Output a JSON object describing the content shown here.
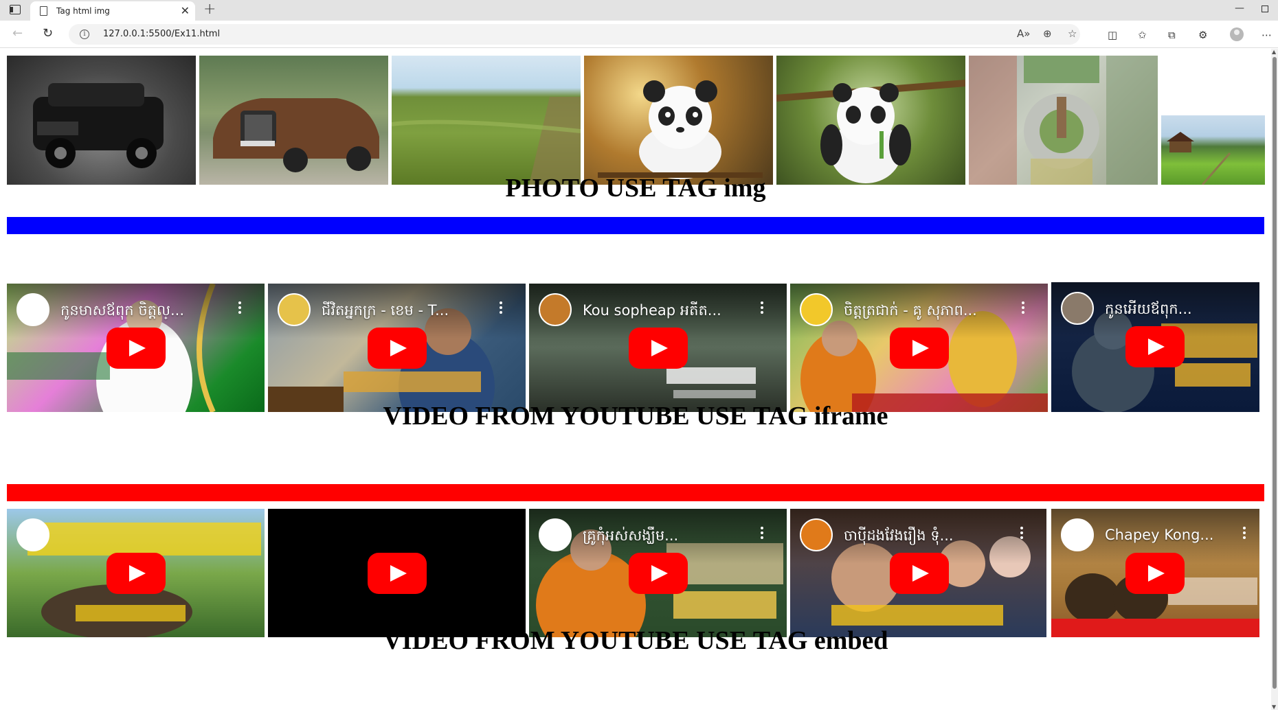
{
  "browser": {
    "tab_title": "Tag html img",
    "url": "127.0.0.1:5500/Ex11.html",
    "close_glyph": "✕",
    "new_tab_glyph": "+"
  },
  "icons": {
    "back": "back-arrow-icon",
    "reload": "reload-icon",
    "info": "info-icon",
    "read_aloud": "read-aloud-icon",
    "zoom": "zoom-icon",
    "favorite": "star-icon",
    "split": "split-screen-icon",
    "favorites": "favorites-icon",
    "collections": "collections-icon",
    "extensions": "extensions-icon",
    "profile": "profile-icon",
    "more": "more-icon",
    "play": "youtube-play-icon"
  },
  "page": {
    "heading_img": "PHOTO USE TAG img",
    "heading_iframe": "VIDEO FROM YOUTUBE USE TAG iframe",
    "heading_embed": "VIDEO FROM YOUTUBE USE TAG embed",
    "bar_blue_color": "#0000ff",
    "bar_red_color": "#ff0000"
  },
  "photos": [
    {
      "subject": "black SUV"
    },
    {
      "subject": "bronze sedan"
    },
    {
      "subject": "rice field"
    },
    {
      "subject": "cartoon panda"
    },
    {
      "subject": "panda on swing"
    },
    {
      "subject": "roundabout aerial view"
    },
    {
      "subject": "village rice field"
    }
  ],
  "iframe_videos": [
    {
      "title": "កូនមាសឪពុក ចិត្តល្..."
    },
    {
      "title": "ជីវិតអ្នកក្រ - ខេម - T..."
    },
    {
      "title": "Kou sopheap អតីត..."
    },
    {
      "title": "ចិត្តត្រជាក់ - គូ សុភាព..."
    },
    {
      "title": "កូនអើយឪពុក..."
    }
  ],
  "embed_videos": [
    {
      "title": ""
    },
    {
      "title": ""
    },
    {
      "title": "គ្រូកុំអស់សង្ឃឹម..."
    },
    {
      "title": "ចាប៉ីដងវែងរឿង ទុំ..."
    },
    {
      "title": "Chapey Kong..."
    }
  ]
}
